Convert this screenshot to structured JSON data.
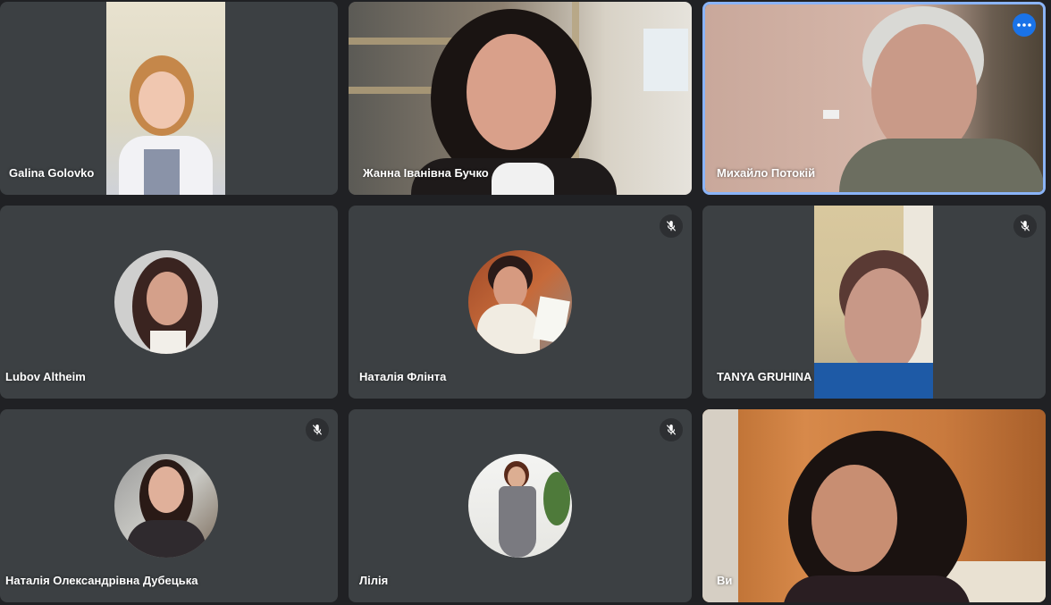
{
  "participants": [
    {
      "name": "Galina Golovko",
      "muted": false
    },
    {
      "name": "Жанна Іванівна Бучко",
      "muted": false
    },
    {
      "name": "Михайло Потокій",
      "muted": false,
      "speaking": true
    },
    {
      "name": "Lubov Altheim",
      "muted": false
    },
    {
      "name": "Наталія Флінта",
      "muted": true
    },
    {
      "name": "TANYA GRUHINA",
      "muted": true
    },
    {
      "name": "Наталія Олександрівна Дубецька",
      "muted": true
    },
    {
      "name": "Лілія",
      "muted": true
    },
    {
      "name": "Ви",
      "muted": false
    }
  ],
  "icons": {
    "mic_off": "mic-off-icon",
    "more": "more-options-icon"
  },
  "colors": {
    "background": "#202124",
    "tile": "#3c4043",
    "speaking_border": "#8ab4f8",
    "more_button": "#1a73e8"
  }
}
